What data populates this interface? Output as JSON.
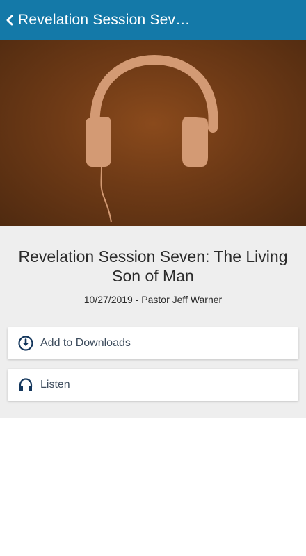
{
  "header": {
    "title": "Revelation Session Seve…"
  },
  "hero": {
    "image": "headphones-artwork",
    "background_color": "#6e3a16",
    "icon_color": "#d39a74"
  },
  "session": {
    "title": "Revelation Session Seven: The Living Son of Man",
    "meta": "10/27/2019 - Pastor Jeff Warner"
  },
  "actions": [
    {
      "label": "Add to Downloads",
      "icon": "download-circle-icon"
    },
    {
      "label": "Listen",
      "icon": "headphones-icon"
    }
  ],
  "colors": {
    "accent": "#1479a8",
    "icon": "#13365c"
  }
}
